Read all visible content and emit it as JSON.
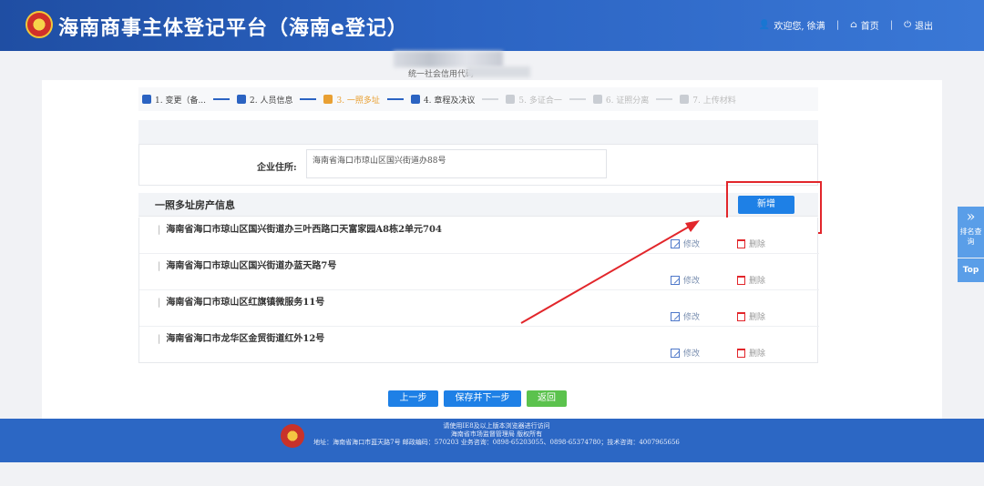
{
  "header": {
    "title": "海南商事主体登记平台（海南e登记）",
    "welcome": "欢迎您, 徐满",
    "home": "首页",
    "logout": "退出"
  },
  "credit_code_label": "统一社会信用代码",
  "steps": [
    {
      "label": "1. 变更（备..."
    },
    {
      "label": "2. 人员信息"
    },
    {
      "label": "3. 一照多址"
    },
    {
      "label": "4. 章程及决议"
    },
    {
      "label": "5. 多证合一"
    },
    {
      "label": "6. 证照分离"
    },
    {
      "label": "7. 上传材料"
    }
  ],
  "address": {
    "label": "企业住所:",
    "value": "海南省海口市琼山区国兴街道办88号"
  },
  "section": {
    "title": "一照多址房产信息",
    "add_label": "新增"
  },
  "rows": [
    {
      "text": "海南省海口市琼山区国兴街道办三叶西路口天富家园A8栋2单元704",
      "edit": "修改",
      "delete": "删除"
    },
    {
      "text": "海南省海口市琼山区国兴街道办蓝天路7号",
      "edit": "修改",
      "delete": "删除"
    },
    {
      "text": "海南省海口市琼山区红旗镇微服务11号",
      "edit": "修改",
      "delete": "删除"
    },
    {
      "text": "海南省海口市龙华区金贸街道红外12号",
      "edit": "修改",
      "delete": "删除"
    }
  ],
  "buttons": {
    "prev": "上一步",
    "save_next": "保存并下一步",
    "back": "返回"
  },
  "footer": {
    "line1": "请使用IE8及以上版本浏览器进行访问",
    "line2": "海南省市场监督管理局 版权所有",
    "line3": "地址：海南省海口市蓝天路7号 邮政编码：570203 业务咨询：0898-65203055、0898-65374780；技术咨询：4007965656"
  },
  "side": {
    "label": "排名查询",
    "top": "Top"
  },
  "colors": {
    "header": "#2b63c2",
    "primary_button": "#1e80e6",
    "back_button": "#5bc24d",
    "highlight": "#e2262b"
  }
}
